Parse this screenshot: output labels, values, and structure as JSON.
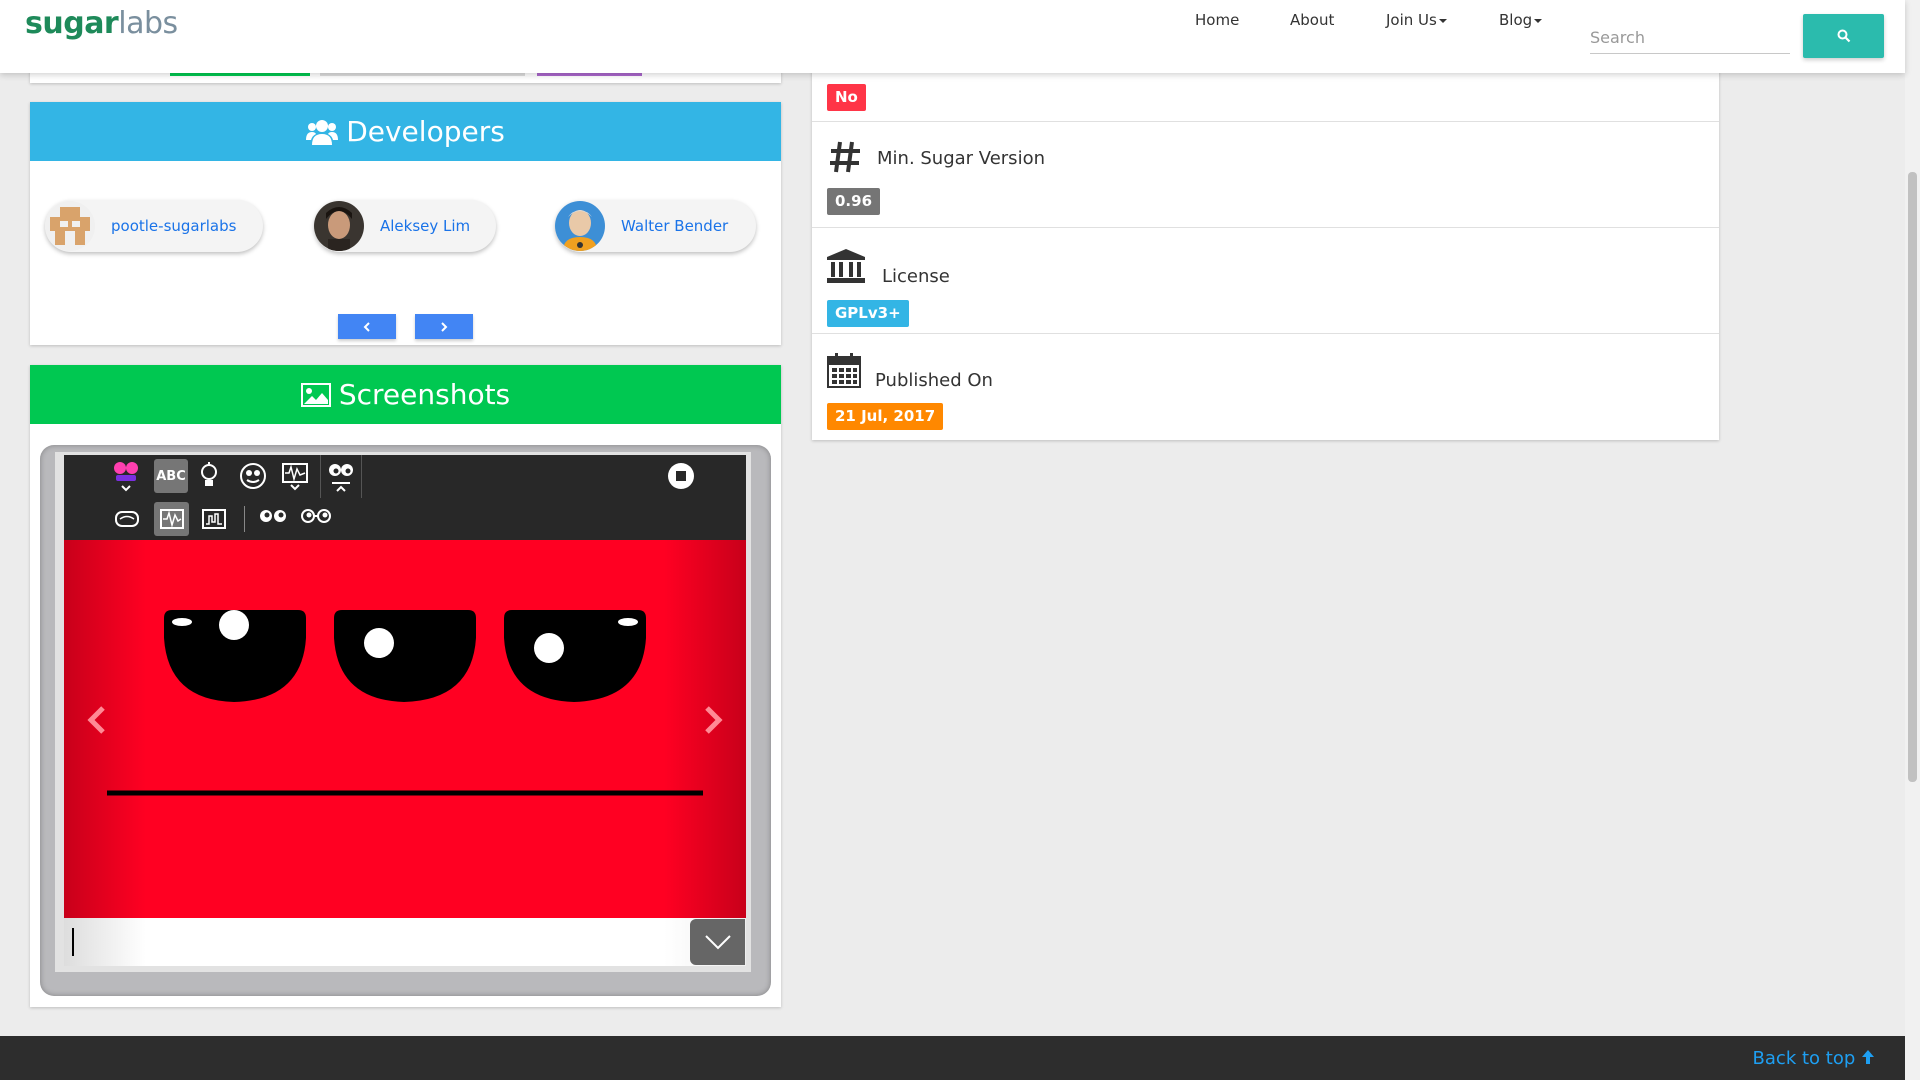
{
  "nav": {
    "logo_a": "sugar",
    "logo_b": "labs",
    "home": "Home",
    "about": "About",
    "join": "Join Us",
    "blog": "Blog",
    "search_placeholder": "Search"
  },
  "developers": {
    "title": "Developers",
    "people": [
      {
        "name": "pootle-sugarlabs"
      },
      {
        "name": "Aleksey Lim"
      },
      {
        "name": "Walter Bender"
      }
    ]
  },
  "screenshots": {
    "title": "Screenshots"
  },
  "info": {
    "top_badge": "No",
    "min_version_label": "Min. Sugar Version",
    "min_version_value": "0.96",
    "license_label": "License",
    "license_value": "GPLv3+",
    "published_label": "Published On",
    "published_value": "21 Jul, 2017"
  },
  "footer": {
    "back_to_top": "Back to top"
  },
  "colors": {
    "developers_header": "#33b5e5",
    "screenshots_header": "#00c851",
    "search_button": "#2bbbad",
    "pager_button": "#4285f4",
    "badge_no": "#ff3547",
    "badge_version": "#757575",
    "badge_license": "#33b5e5",
    "badge_published": "#ff8800"
  }
}
